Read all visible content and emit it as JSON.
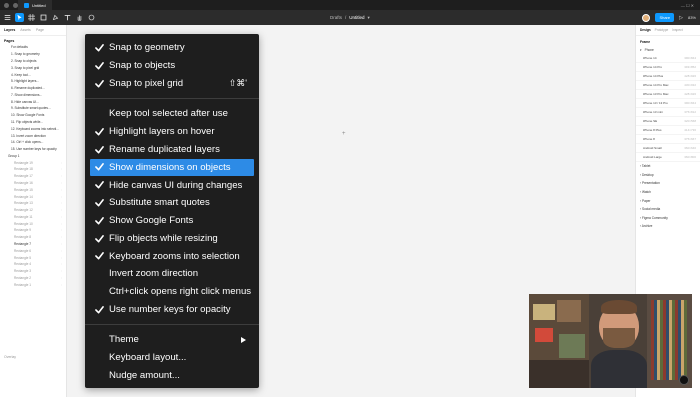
{
  "browser": {
    "tabs": [
      "Untitled"
    ],
    "window_controls": "—  ☐  ✕"
  },
  "toolbar": {
    "tools": [
      "menu-icon",
      "move-icon",
      "frame-icon",
      "shape-icon",
      "pen-icon",
      "text-icon",
      "hand-icon",
      "comment-icon"
    ],
    "project": "Drafts",
    "separator": "/",
    "file_name": "Untitled",
    "share_label": "Share",
    "zoom": "83%"
  },
  "left_panel": {
    "tabs": [
      "Layers",
      "Assets",
      "Page"
    ],
    "pages_heading": "Pages",
    "pages": [
      "For defaults",
      "1. Snap to geometry",
      "2. Snap to objects",
      "3. Snap to pixel grid",
      "4. Keep tool...",
      "5. Highlight layers...",
      "6. Rename duplicated...",
      "7. Show dimensions...",
      "8. Hide canvas UI...",
      "9. Substitute smart quotes...",
      "10. Show Google Fonts",
      "11. Flip objects while...",
      "12. Keyboard zooms into selecti...",
      "13. Invert zoom direction",
      "14. Ctrl + click opens...",
      "15. Use number keys for opacity"
    ],
    "group_label": "Group 1",
    "layers": [
      "Rectangle 19",
      "Rectangle 18",
      "Rectangle 17",
      "Rectangle 16",
      "Rectangle 15",
      "Rectangle 14",
      "Rectangle 13",
      "Rectangle 12",
      "Rectangle 11",
      "Rectangle 10",
      "Rectangle 9",
      "Rectangle 8",
      "Rectangle 7",
      "Rectangle 6",
      "Rectangle 5",
      "Rectangle 4",
      "Rectangle 3",
      "Rectangle 2",
      "Rectangle 1"
    ],
    "selected_layer": "Rectangle 7",
    "footer": "Overlay"
  },
  "right_panel": {
    "tabs": [
      "Design",
      "Prototype",
      "Inspect"
    ],
    "section": "Frame",
    "category": "Phone",
    "devices": [
      {
        "name": "iPhone 14",
        "size": "390×844"
      },
      {
        "name": "iPhone 14 Pro",
        "size": "393×852"
      },
      {
        "name": "iPhone 14 Plus",
        "size": "428×926"
      },
      {
        "name": "iPhone 14 Pro Max",
        "size": "430×932"
      },
      {
        "name": "iPhone 13 Pro Max",
        "size": "428×926"
      },
      {
        "name": "iPhone 13 / 13 Pro",
        "size": "390×844"
      },
      {
        "name": "iPhone 13 mini",
        "size": "375×812"
      },
      {
        "name": "iPhone SE",
        "size": "320×568"
      },
      {
        "name": "iPhone 8 Plus",
        "size": "414×736"
      },
      {
        "name": "iPhone 8",
        "size": "375×667"
      },
      {
        "name": "Android Small",
        "size": "360×640"
      },
      {
        "name": "Android Large",
        "size": "360×800"
      }
    ],
    "groups": [
      "Tablet",
      "Desktop",
      "Presentation",
      "Watch",
      "Paper",
      "Social media",
      "Figma Community",
      "Archive"
    ]
  },
  "menu": {
    "items": [
      {
        "label": "Snap to geometry",
        "checked": true
      },
      {
        "label": "Snap to objects",
        "checked": true
      },
      {
        "label": "Snap to pixel grid",
        "checked": true,
        "shortcut": "⇧⌘'"
      },
      {
        "label": "Keep tool selected after use",
        "checked": false
      },
      {
        "label": "Highlight layers on hover",
        "checked": true
      },
      {
        "label": "Rename duplicated layers",
        "checked": true
      },
      {
        "label": "Show dimensions on objects",
        "checked": true,
        "highlighted": true
      },
      {
        "label": "Hide canvas UI during changes",
        "checked": true
      },
      {
        "label": "Substitute smart quotes",
        "checked": true
      },
      {
        "label": "Show Google Fonts",
        "checked": true
      },
      {
        "label": "Flip objects while resizing",
        "checked": true
      },
      {
        "label": "Keyboard zooms into selection",
        "checked": true
      },
      {
        "label": "Invert zoom direction",
        "checked": false
      },
      {
        "label": "Ctrl+click opens right click menus",
        "checked": false
      },
      {
        "label": "Use number keys for opacity",
        "checked": true
      },
      {
        "label": "Theme",
        "checked": false,
        "submenu": true
      },
      {
        "label": "Keyboard layout...",
        "checked": false
      },
      {
        "label": "Nudge amount...",
        "checked": false
      }
    ]
  },
  "colors": {
    "menu_bg": "#1e1e1e",
    "highlight": "#2d8be6",
    "accent": "#0d99ff",
    "toolbar_bg": "#2c2c2c",
    "canvas_bg": "#f3f3f3"
  }
}
